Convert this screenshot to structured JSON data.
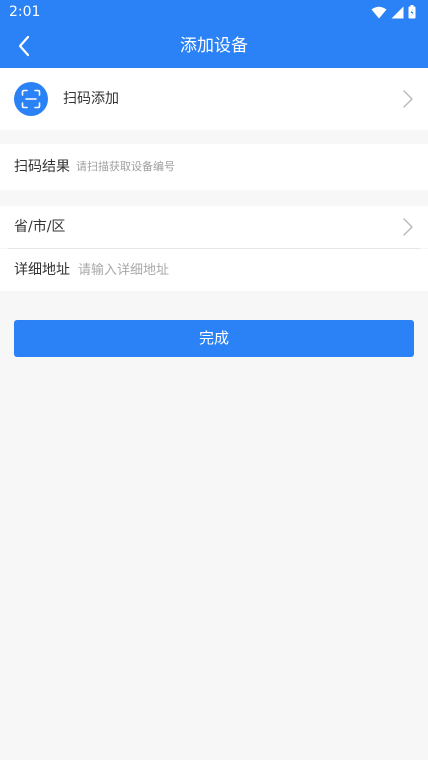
{
  "status_bar": {
    "time": "2:01"
  },
  "nav": {
    "title": "添加设备"
  },
  "scan": {
    "label": "扫码添加"
  },
  "result": {
    "label": "扫码结果",
    "value": "请扫描获取设备编号"
  },
  "region": {
    "label": "省/市/区"
  },
  "address": {
    "label": "详细地址",
    "placeholder": "请输入详细地址"
  },
  "actions": {
    "done_label": "完成"
  },
  "colors": {
    "primary": "#2b82f6",
    "background": "#f7f7f7"
  },
  "icons": [
    "wifi-icon",
    "signal-icon",
    "battery-icon",
    "back-arrow-icon",
    "scan-icon",
    "chevron-right-icon"
  ]
}
